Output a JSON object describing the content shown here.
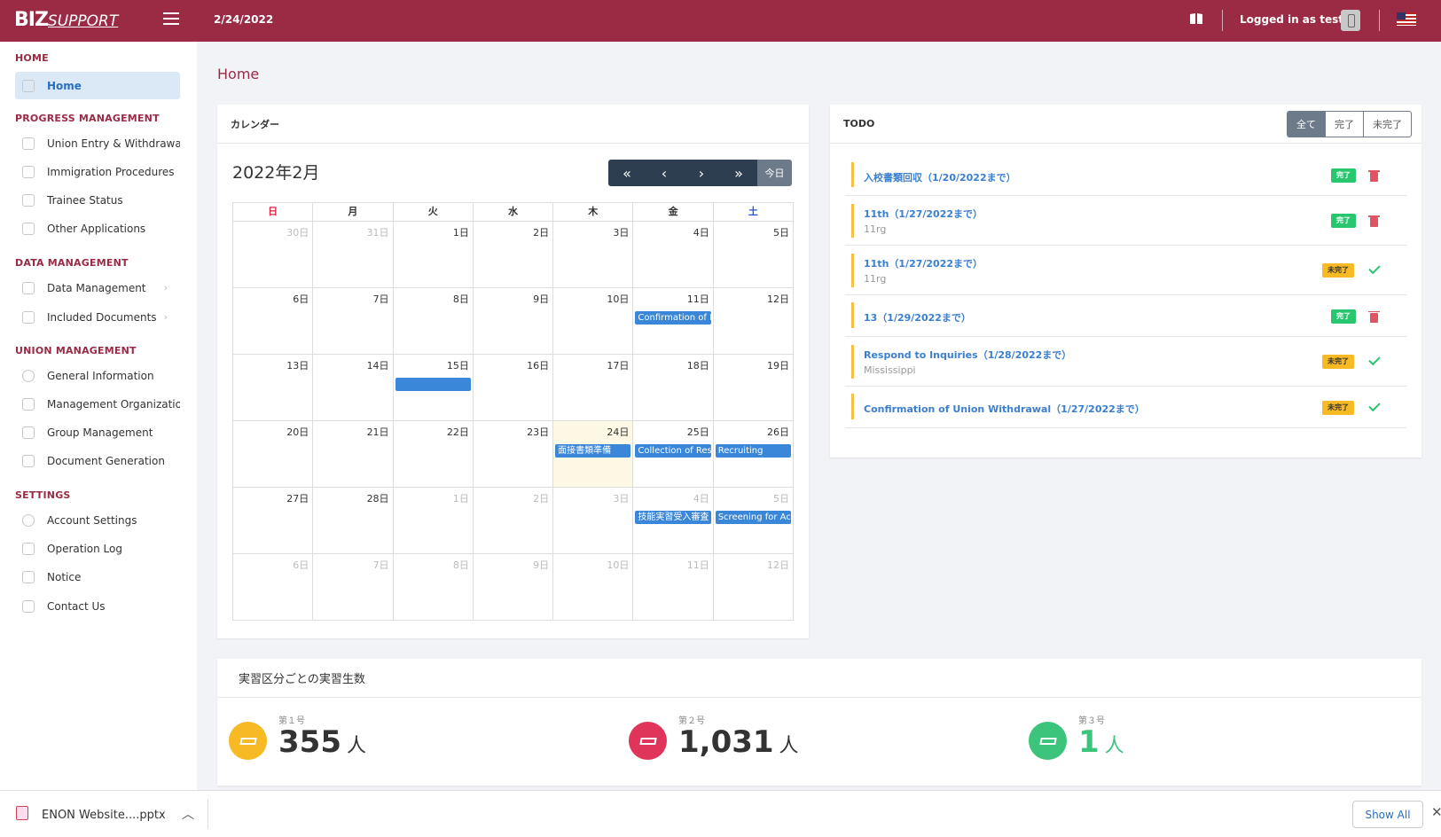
{
  "header": {
    "logo_main": "BIZ",
    "logo_sub": "SUPPORT",
    "date": "2/24/2022",
    "logged_in": "Logged in as test"
  },
  "page": {
    "title": "Home"
  },
  "sidebar": {
    "sections": [
      {
        "title": "HOME",
        "items": [
          {
            "label": "Home",
            "active": true
          }
        ]
      },
      {
        "title": "PROGRESS MANAGEMENT",
        "items": [
          {
            "label": "Union Entry & Withdrawal"
          },
          {
            "label": "Immigration Procedures"
          },
          {
            "label": "Trainee Status"
          },
          {
            "label": "Other Applications"
          }
        ]
      },
      {
        "title": "DATA MANAGEMENT",
        "items": [
          {
            "label": "Data Management"
          },
          {
            "label": "Included Documents"
          }
        ]
      },
      {
        "title": "UNION MANAGEMENT",
        "items": [
          {
            "label": "General Information"
          },
          {
            "label": "Management Organization Offi"
          },
          {
            "label": "Group Management"
          },
          {
            "label": "Document Generation"
          }
        ]
      },
      {
        "title": "SETTINGS",
        "items": [
          {
            "label": "Account Settings"
          },
          {
            "label": "Operation Log"
          },
          {
            "label": "Notice"
          },
          {
            "label": "Contact Us"
          }
        ]
      }
    ]
  },
  "calendar": {
    "card_title": "カレンダー",
    "month_label": "2022年2月",
    "today_label": "今日",
    "nav": [
      "«",
      "‹",
      "›",
      "»"
    ],
    "weekdays": [
      "日",
      "月",
      "火",
      "水",
      "木",
      "金",
      "土"
    ],
    "weekday_colors": [
      "#e0253f",
      "#333333",
      "#333333",
      "#333333",
      "#333333",
      "#333333",
      "#2a55d0"
    ],
    "weeks": [
      [
        {
          "d": "30日",
          "o": true
        },
        {
          "d": "31日",
          "o": true
        },
        {
          "d": "1日"
        },
        {
          "d": "2日"
        },
        {
          "d": "3日"
        },
        {
          "d": "4日"
        },
        {
          "d": "5日"
        }
      ],
      [
        {
          "d": "6日"
        },
        {
          "d": "7日"
        },
        {
          "d": "8日"
        },
        {
          "d": "9日"
        },
        {
          "d": "10日"
        },
        {
          "d": "11日",
          "ev": "Confirmation of M"
        },
        {
          "d": "12日"
        }
      ],
      [
        {
          "d": "13日"
        },
        {
          "d": "14日"
        },
        {
          "d": "15日",
          "ev": ""
        },
        {
          "d": "16日"
        },
        {
          "d": "17日"
        },
        {
          "d": "18日"
        },
        {
          "d": "19日"
        }
      ],
      [
        {
          "d": "20日"
        },
        {
          "d": "21日"
        },
        {
          "d": "22日"
        },
        {
          "d": "23日"
        },
        {
          "d": "24日",
          "today": true,
          "ev": "面接書類準備"
        },
        {
          "d": "25日",
          "ev": "Collection of Resu"
        },
        {
          "d": "26日",
          "ev": "Recruiting"
        }
      ],
      [
        {
          "d": "27日"
        },
        {
          "d": "28日"
        },
        {
          "d": "1日",
          "o": true
        },
        {
          "d": "2日",
          "o": true
        },
        {
          "d": "3日",
          "o": true
        },
        {
          "d": "4日",
          "o": true,
          "ev": "技能実習受入審査"
        },
        {
          "d": "5日",
          "o": true,
          "ev": "Screening for Ac"
        }
      ],
      [
        {
          "d": "6日",
          "o": true
        },
        {
          "d": "7日",
          "o": true
        },
        {
          "d": "8日",
          "o": true
        },
        {
          "d": "9日",
          "o": true
        },
        {
          "d": "10日",
          "o": true
        },
        {
          "d": "11日",
          "o": true
        },
        {
          "d": "12日",
          "o": true
        }
      ]
    ]
  },
  "todo": {
    "card_title": "TODO",
    "filters": [
      "全て",
      "完了",
      "未完了"
    ],
    "items": [
      {
        "title": "入校書類回収（1/20/2022まで）",
        "sub": "",
        "status": "完了",
        "done": true
      },
      {
        "title": "11th（1/27/2022まで）",
        "sub": "11rg",
        "status": "完了",
        "done": true
      },
      {
        "title": "11th（1/27/2022まで）",
        "sub": "11rg",
        "status": "未完了",
        "done": false
      },
      {
        "title": "13（1/29/2022まで）",
        "sub": "",
        "status": "完了",
        "done": true
      },
      {
        "title": "Respond to Inquiries（1/28/2022まで）",
        "sub": "Mississippi",
        "status": "未完了",
        "done": false
      },
      {
        "title": "Confirmation of Union Withdrawal（1/27/2022まで）",
        "sub": "",
        "status": "未完了",
        "done": false
      }
    ]
  },
  "stats": {
    "card_title": "実習区分ごとの実習生数",
    "items": [
      {
        "label": "第１号",
        "value": "355",
        "unit": "人",
        "color": "#f7b924",
        "value_color": "#333333"
      },
      {
        "label": "第２号",
        "value": "1,031",
        "unit": "人",
        "color": "#e0355a",
        "value_color": "#333333"
      },
      {
        "label": "第３号",
        "value": "1",
        "unit": "人",
        "color": "#3cc47c",
        "value_color": "#3cc47c"
      }
    ]
  },
  "download_bar": {
    "file_name": "ENON Website....pptx",
    "show_all": "Show All"
  }
}
